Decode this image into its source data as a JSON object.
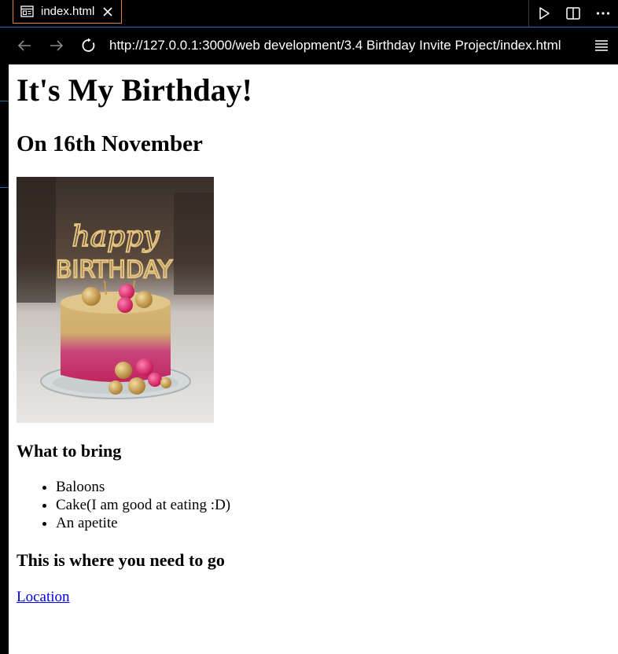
{
  "tab": {
    "label": "index.html"
  },
  "nav": {
    "url": "http://127.0.0.1:3000/web development/3.4 Birthday Invite Project/index.html"
  },
  "page": {
    "title": "It's My Birthday!",
    "date": "On 16th November",
    "image_topper_text": [
      "happy",
      "BIRTHDAY"
    ],
    "bring_heading": "What to bring",
    "bring_items": [
      "Baloons",
      "Cake(I am good at eating :D)",
      "An apetite"
    ],
    "go_heading": "This is where you need to go",
    "location_link": "Location"
  },
  "icons": {
    "tab": "preview-icon",
    "close": "close-icon",
    "run": "play-icon",
    "split": "split-editor-icon",
    "more": "more-actions-icon",
    "back": "back-arrow-icon",
    "forward": "forward-arrow-icon",
    "reload": "reload-icon",
    "menu": "menu-icon"
  },
  "colors": {
    "tab_border": "#d9823b",
    "accent": "#2b6f9f",
    "link": "#0000ee"
  }
}
